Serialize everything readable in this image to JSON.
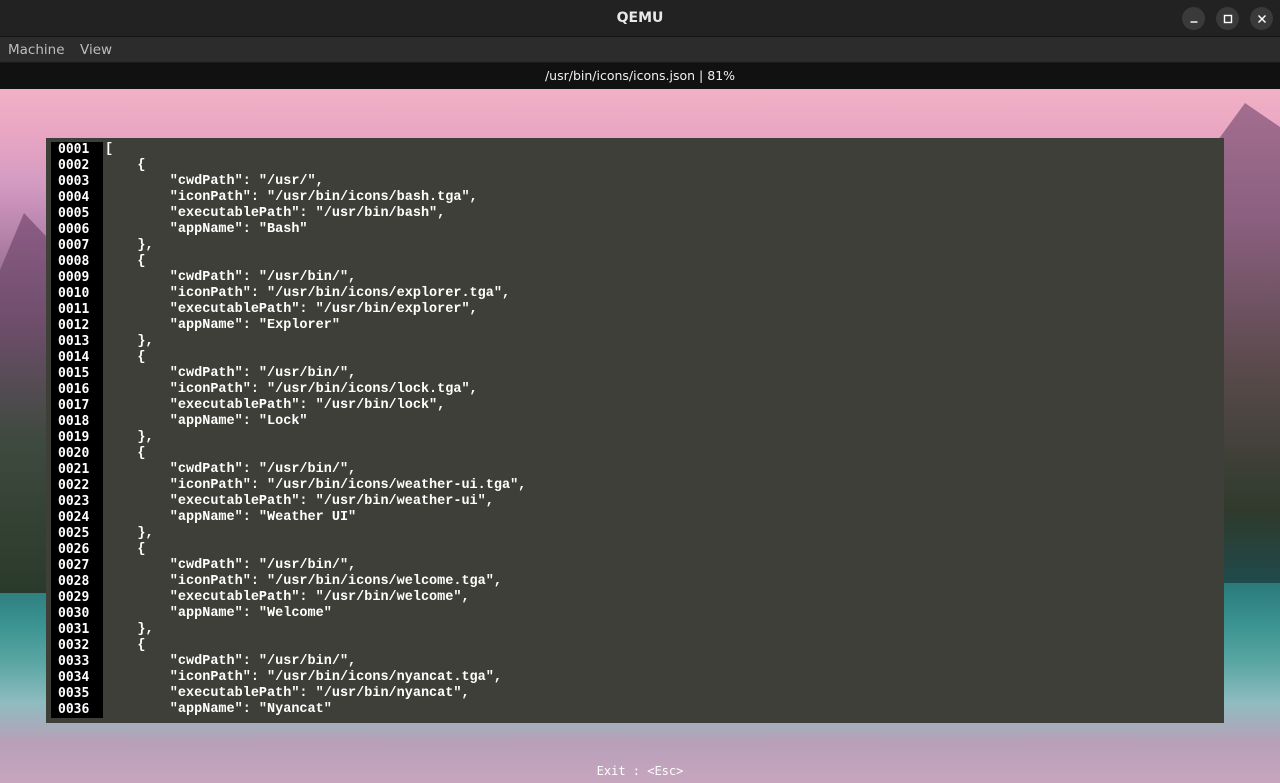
{
  "window": {
    "title": "QEMU"
  },
  "menu": {
    "machine": "Machine",
    "view": "View"
  },
  "statusbar": {
    "text": "/usr/bin/icons/icons.json  |  81%"
  },
  "viewer": {
    "lines": [
      {
        "num": "0001",
        "text": "["
      },
      {
        "num": "0002",
        "text": "    {"
      },
      {
        "num": "0003",
        "text": "        \"cwdPath\": \"/usr/\","
      },
      {
        "num": "0004",
        "text": "        \"iconPath\": \"/usr/bin/icons/bash.tga\","
      },
      {
        "num": "0005",
        "text": "        \"executablePath\": \"/usr/bin/bash\","
      },
      {
        "num": "0006",
        "text": "        \"appName\": \"Bash\""
      },
      {
        "num": "0007",
        "text": "    },"
      },
      {
        "num": "0008",
        "text": "    {"
      },
      {
        "num": "0009",
        "text": "        \"cwdPath\": \"/usr/bin/\","
      },
      {
        "num": "0010",
        "text": "        \"iconPath\": \"/usr/bin/icons/explorer.tga\","
      },
      {
        "num": "0011",
        "text": "        \"executablePath\": \"/usr/bin/explorer\","
      },
      {
        "num": "0012",
        "text": "        \"appName\": \"Explorer\""
      },
      {
        "num": "0013",
        "text": "    },"
      },
      {
        "num": "0014",
        "text": "    {"
      },
      {
        "num": "0015",
        "text": "        \"cwdPath\": \"/usr/bin/\","
      },
      {
        "num": "0016",
        "text": "        \"iconPath\": \"/usr/bin/icons/lock.tga\","
      },
      {
        "num": "0017",
        "text": "        \"executablePath\": \"/usr/bin/lock\","
      },
      {
        "num": "0018",
        "text": "        \"appName\": \"Lock\""
      },
      {
        "num": "0019",
        "text": "    },"
      },
      {
        "num": "0020",
        "text": "    {"
      },
      {
        "num": "0021",
        "text": "        \"cwdPath\": \"/usr/bin/\","
      },
      {
        "num": "0022",
        "text": "        \"iconPath\": \"/usr/bin/icons/weather-ui.tga\","
      },
      {
        "num": "0023",
        "text": "        \"executablePath\": \"/usr/bin/weather-ui\","
      },
      {
        "num": "0024",
        "text": "        \"appName\": \"Weather UI\""
      },
      {
        "num": "0025",
        "text": "    },"
      },
      {
        "num": "0026",
        "text": "    {"
      },
      {
        "num": "0027",
        "text": "        \"cwdPath\": \"/usr/bin/\","
      },
      {
        "num": "0028",
        "text": "        \"iconPath\": \"/usr/bin/icons/welcome.tga\","
      },
      {
        "num": "0029",
        "text": "        \"executablePath\": \"/usr/bin/welcome\","
      },
      {
        "num": "0030",
        "text": "        \"appName\": \"Welcome\""
      },
      {
        "num": "0031",
        "text": "    },"
      },
      {
        "num": "0032",
        "text": "    {"
      },
      {
        "num": "0033",
        "text": "        \"cwdPath\": \"/usr/bin/\","
      },
      {
        "num": "0034",
        "text": "        \"iconPath\": \"/usr/bin/icons/nyancat.tga\","
      },
      {
        "num": "0035",
        "text": "        \"executablePath\": \"/usr/bin/nyancat\","
      },
      {
        "num": "0036",
        "text": "        \"appName\": \"Nyancat\""
      }
    ]
  },
  "hint": {
    "text": "Exit : <Esc>"
  },
  "icons": {
    "minimize": "minimize-icon",
    "maximize": "maximize-icon",
    "close": "close-icon"
  }
}
